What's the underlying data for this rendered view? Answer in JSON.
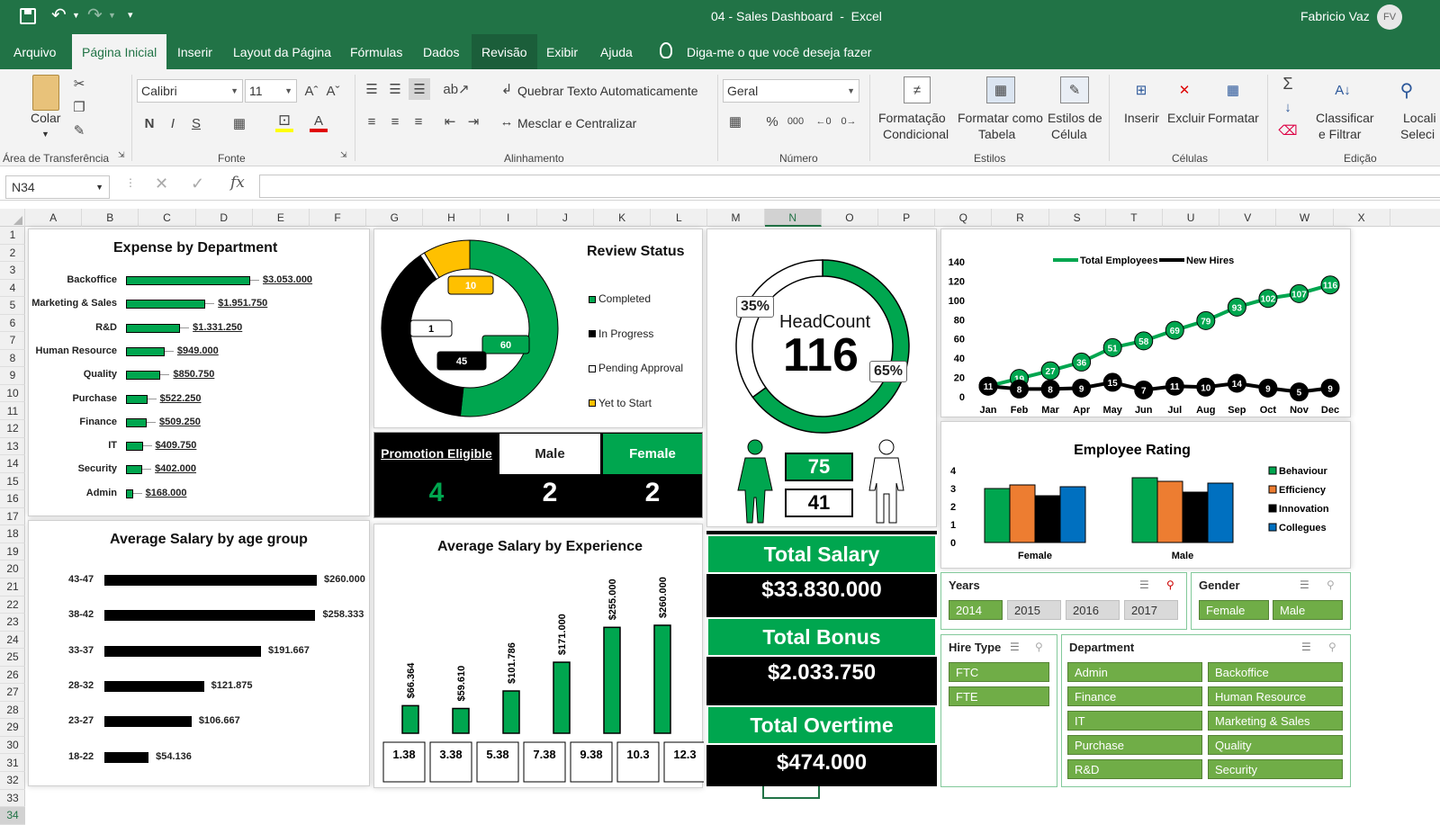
{
  "window": {
    "title": "04 - Sales Dashboard  -  Excel",
    "user": "Fabricio Vaz",
    "avatar": "FV"
  },
  "menu": [
    "Arquivo",
    "Página Inicial",
    "Inserir",
    "Layout da Página",
    "Fórmulas",
    "Dados",
    "Revisão",
    "Exibir",
    "Ajuda",
    "Diga-me o que você deseja fazer"
  ],
  "ribbon": {
    "clipboard": {
      "paste": "Colar",
      "label": "Área de Transferência"
    },
    "font": {
      "name": "Calibri",
      "size": "11",
      "bold": "N",
      "italic": "I",
      "underline": "S",
      "label": "Fonte"
    },
    "alignment": {
      "wrap": "Quebrar Texto Automaticamente",
      "merge": "Mesclar e Centralizar",
      "label": "Alinhamento"
    },
    "number": {
      "format": "Geral",
      "label": "Número",
      "percent": "%",
      "thousands": "000"
    },
    "styles": {
      "cond1": "Formatação",
      "cond2": "Condicional",
      "table1": "Formatar como",
      "table2": "Tabela",
      "cell1": "Estilos de",
      "cell2": "Célula",
      "label": "Estilos"
    },
    "cells": {
      "insert": "Inserir",
      "delete": "Excluir",
      "format": "Formatar",
      "label": "Células"
    },
    "editing": {
      "sort1": "Classificar",
      "sort2": "e Filtrar",
      "find1": "Locali",
      "find2": "Seleci",
      "label": "Edição"
    }
  },
  "namebox": "N34",
  "columns": [
    "A",
    "B",
    "C",
    "D",
    "E",
    "F",
    "G",
    "H",
    "I",
    "J",
    "K",
    "L",
    "M",
    "N",
    "O",
    "P",
    "Q",
    "R",
    "S",
    "T",
    "U",
    "V",
    "W",
    "X"
  ],
  "selected_col": "N",
  "rows": [
    "1",
    "2",
    "3",
    "4",
    "5",
    "6",
    "7",
    "8",
    "9",
    "10",
    "11",
    "12",
    "13",
    "14",
    "15",
    "16",
    "17",
    "18",
    "19",
    "20",
    "21",
    "22",
    "23",
    "24",
    "25",
    "26",
    "27",
    "28",
    "29",
    "30",
    "31",
    "32",
    "33",
    "34"
  ],
  "selected_row": "34",
  "expense": {
    "title": "Expense by Department",
    "items": [
      {
        "label": "Backoffice",
        "value": 3053000,
        "text": "$3.053.000"
      },
      {
        "label": "Marketing & Sales",
        "value": 1951750,
        "text": "$1.951.750"
      },
      {
        "label": "R&D",
        "value": 1331250,
        "text": "$1.331.250"
      },
      {
        "label": "Human Resource",
        "value": 949000,
        "text": "$949.000"
      },
      {
        "label": "Quality",
        "value": 850750,
        "text": "$850.750"
      },
      {
        "label": "Purchase",
        "value": 522250,
        "text": "$522.250"
      },
      {
        "label": "Finance",
        "value": 509250,
        "text": "$509.250"
      },
      {
        "label": "IT",
        "value": 409750,
        "text": "$409.750"
      },
      {
        "label": "Security",
        "value": 402000,
        "text": "$402.000"
      },
      {
        "label": "Admin",
        "value": 168000,
        "text": "$168.000"
      }
    ]
  },
  "review": {
    "title": "Review Status",
    "items": [
      {
        "label": "Completed",
        "value": 60,
        "color": "#00a64f"
      },
      {
        "label": "In Progress",
        "value": 45,
        "color": "#000000"
      },
      {
        "label": "Pending Approval",
        "value": 1,
        "color": "#ffffff"
      },
      {
        "label": "Yet to Start",
        "value": 10,
        "color": "#ffc000"
      }
    ]
  },
  "promotion": {
    "title": "Promotion Eligible",
    "male_label": "Male",
    "female_label": "Female",
    "total": "4",
    "male": "2",
    "female": "2"
  },
  "headcount": {
    "title": "HeadCount",
    "value": "116",
    "pct_female": "35%",
    "pct_male": "65%",
    "female": "75",
    "male": "41",
    "female_frac": 0.35,
    "male_frac": 0.65
  },
  "totals": {
    "salary_label": "Total Salary",
    "salary": "$33.830.000",
    "bonus_label": "Total Bonus",
    "bonus": "$2.033.750",
    "overtime_label": "Total Overtime",
    "overtime": "$474.000"
  },
  "age_salary": {
    "title": "Average Salary by age group",
    "items": [
      {
        "label": "43-47",
        "value": 260000,
        "text": "$260.000"
      },
      {
        "label": "38-42",
        "value": 258333,
        "text": "$258.333"
      },
      {
        "label": "33-37",
        "value": 191667,
        "text": "$191.667"
      },
      {
        "label": "28-32",
        "value": 121875,
        "text": "$121.875"
      },
      {
        "label": "23-27",
        "value": 106667,
        "text": "$106.667"
      },
      {
        "label": "18-22",
        "value": 54136,
        "text": "$54.136"
      }
    ]
  },
  "chart_data": [
    {
      "type": "line",
      "legend": [
        "Total Employees",
        "New Hires"
      ],
      "categories": [
        "Jan",
        "Feb",
        "Mar",
        "Apr",
        "May",
        "Jun",
        "Jul",
        "Aug",
        "Sep",
        "Oct",
        "Nov",
        "Dec"
      ],
      "series": [
        {
          "name": "Total Employees",
          "values": [
            11,
            19,
            27,
            36,
            51,
            58,
            69,
            79,
            93,
            102,
            107,
            116
          ],
          "color": "#00a64f"
        },
        {
          "name": "New Hires",
          "values": [
            11,
            8,
            8,
            9,
            15,
            7,
            11,
            10,
            14,
            9,
            5,
            9
          ],
          "color": "#000000"
        }
      ],
      "yticks": [
        "140",
        "120",
        "100",
        "80",
        "60",
        "40",
        "20",
        "0"
      ],
      "ylim": [
        0,
        140
      ]
    },
    {
      "type": "bar",
      "title": "Employee Rating",
      "categories": [
        "Female",
        "Male"
      ],
      "series": [
        {
          "name": "Behaviour",
          "values": [
            3,
            3.6
          ],
          "color": "#00a64f"
        },
        {
          "name": "Efficiency",
          "values": [
            3.2,
            3.4
          ],
          "color": "#ed7d31"
        },
        {
          "name": "Innovation",
          "values": [
            2.6,
            2.8
          ],
          "color": "#000000"
        },
        {
          "name": "Collegues",
          "values": [
            3.1,
            3.3
          ],
          "color": "#0070c0"
        }
      ],
      "yticks": [
        "4",
        "3",
        "2",
        "1",
        "0"
      ],
      "ylim": [
        0,
        4
      ]
    },
    {
      "type": "bar",
      "title": "Average Salary by Experience",
      "categories": [
        "1.38",
        "3.38",
        "5.38",
        "7.38",
        "9.38",
        "10.3",
        "12.3"
      ],
      "values": [
        66364,
        59610,
        101786,
        171000,
        255000,
        260000
      ],
      "value_labels": [
        "$66.364",
        "$59.610",
        "$101.786",
        "$171.000",
        "$255.000",
        "$260.000"
      ]
    }
  ],
  "slicers": {
    "years": {
      "title": "Years",
      "items": [
        {
          "label": "2014",
          "on": true
        },
        {
          "label": "2015",
          "on": false
        },
        {
          "label": "2016",
          "on": false
        },
        {
          "label": "2017",
          "on": false
        }
      ]
    },
    "gender": {
      "title": "Gender",
      "items": [
        {
          "label": "Female",
          "on": true
        },
        {
          "label": "Male",
          "on": true
        }
      ]
    },
    "hire": {
      "title": "Hire Type",
      "items": [
        {
          "label": "FTC",
          "on": true
        },
        {
          "label": "FTE",
          "on": true
        }
      ]
    },
    "department": {
      "title": "Department",
      "items": [
        {
          "label": "Admin"
        },
        {
          "label": "Backoffice"
        },
        {
          "label": "Finance"
        },
        {
          "label": "Human Resource"
        },
        {
          "label": "IT"
        },
        {
          "label": "Marketing & Sales"
        },
        {
          "label": "Purchase"
        },
        {
          "label": "Quality"
        },
        {
          "label": "R&D"
        },
        {
          "label": "Security"
        }
      ]
    }
  }
}
